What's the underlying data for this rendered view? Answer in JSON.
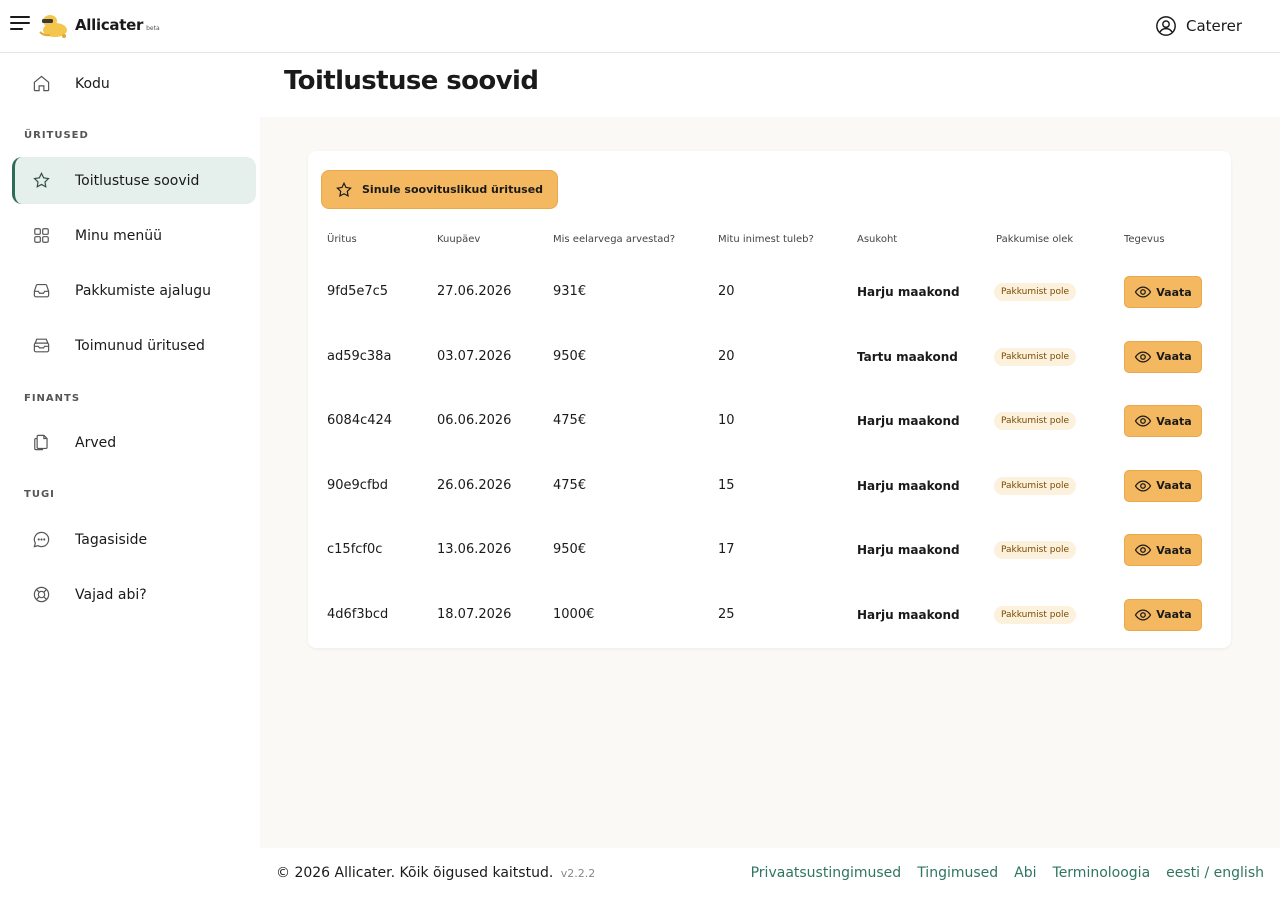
{
  "header": {
    "brand": "Allicater",
    "beta": "beta",
    "user_name": "Caterer"
  },
  "sidebar": {
    "home": "Kodu",
    "section_events": "ÜRITUSED",
    "events_items": [
      {
        "label": "Toitlustuse soovid",
        "icon": "star-icon",
        "active": true
      },
      {
        "label": "Minu menüü",
        "icon": "grid-icon"
      },
      {
        "label": "Pakkumiste ajalugu",
        "icon": "inbox-icon"
      },
      {
        "label": "Toimunud üritused",
        "icon": "archive-icon"
      }
    ],
    "section_finance": "FINANTS",
    "finance_items": [
      {
        "label": "Arved",
        "icon": "documents-icon"
      }
    ],
    "section_support": "TUGI",
    "support_items": [
      {
        "label": "Tagasiside",
        "icon": "chat-icon"
      },
      {
        "label": "Vajad abi?",
        "icon": "lifebuoy-icon"
      }
    ]
  },
  "page": {
    "title": "Toitlustuse soovid",
    "recommended_button": "Sinule soovituslikud üritused"
  },
  "table": {
    "headers": [
      "Üritus",
      "Kuupäev",
      "Mis eelarvega arvestad?",
      "Mitu inimest tuleb?",
      "Asukoht",
      "Pakkumise olek",
      "Tegevus"
    ],
    "rows": [
      {
        "event": "9fd5e7c5",
        "date": "27.06.2026",
        "budget": "931€",
        "people": "20",
        "location": "Harju maakond",
        "status": "Pakkumist pole",
        "action": "Vaata"
      },
      {
        "event": "ad59c38a",
        "date": "03.07.2026",
        "budget": "950€",
        "people": "20",
        "location": "Tartu maakond",
        "status": "Pakkumist pole",
        "action": "Vaata"
      },
      {
        "event": "6084c424",
        "date": "06.06.2026",
        "budget": "475€",
        "people": "10",
        "location": "Harju maakond",
        "status": "Pakkumist pole",
        "action": "Vaata"
      },
      {
        "event": "90e9cfbd",
        "date": "26.06.2026",
        "budget": "475€",
        "people": "15",
        "location": "Harju maakond",
        "status": "Pakkumist pole",
        "action": "Vaata"
      },
      {
        "event": "c15fcf0c",
        "date": "13.06.2026",
        "budget": "950€",
        "people": "17",
        "location": "Harju maakond",
        "status": "Pakkumist pole",
        "action": "Vaata"
      },
      {
        "event": "4d6f3bcd",
        "date": "18.07.2026",
        "budget": "1000€",
        "people": "25",
        "location": "Harju maakond",
        "status": "Pakkumist pole",
        "action": "Vaata"
      }
    ]
  },
  "footer": {
    "copyright": "© 2026 Allicater. Kõik õigused kaitstud.",
    "version": "v2.2.2",
    "links": [
      "Privaatsustingimused",
      "Tingimused",
      "Abi",
      "Terminoloogia",
      "eesti / english"
    ]
  },
  "colors": {
    "accent": "#f4b860",
    "active_nav_bg": "#e5efec",
    "active_nav_border": "#2f6b59",
    "link": "#2f7561",
    "badge_bg": "#fcf1dd"
  }
}
